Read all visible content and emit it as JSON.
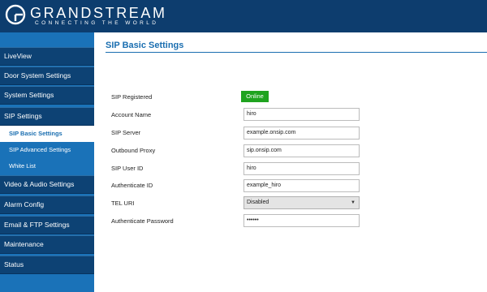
{
  "brand": {
    "name": "GRANDSTREAM",
    "tagline": "CONNECTING THE WORLD"
  },
  "sidebar": {
    "items": [
      {
        "label": "LiveView"
      },
      {
        "label": "Door System Settings"
      },
      {
        "label": "System Settings"
      },
      {
        "label": "SIP Settings"
      },
      {
        "label": "Video & Audio Settings"
      },
      {
        "label": "Alarm Config"
      },
      {
        "label": "Email & FTP Settings"
      },
      {
        "label": "Maintenance"
      },
      {
        "label": "Status"
      }
    ],
    "sub_items": [
      {
        "label": "SIP Basic Settings",
        "active": true
      },
      {
        "label": "SIP Advanced Settings",
        "active": false
      },
      {
        "label": "White List",
        "active": false
      }
    ]
  },
  "main": {
    "title": "SIP Basic Settings",
    "registered_label": "SIP Registered",
    "registered_status": "Online",
    "fields": [
      {
        "label": "Account Name",
        "value": "hiro"
      },
      {
        "label": "SIP Server",
        "value": "example.onsip.com"
      },
      {
        "label": "Outbound Proxy",
        "value": "sip.onsip.com"
      },
      {
        "label": "SIP User ID",
        "value": "hiro"
      },
      {
        "label": "Authenticate ID",
        "value": "example_hiro"
      },
      {
        "label": "TEL URI",
        "value": "Disabled"
      },
      {
        "label": "Authenticate Password",
        "value": "••••••"
      }
    ]
  },
  "colors": {
    "header_bg": "#0d3d6e",
    "sidebar_bg": "#1a72b8",
    "nav_item_bg": "#0d4274",
    "accent": "#1a6eb0",
    "online": "#1fa31f"
  },
  "icons": {
    "logo": "grandstream-logo-icon",
    "select_caret": "caret-down-icon"
  }
}
